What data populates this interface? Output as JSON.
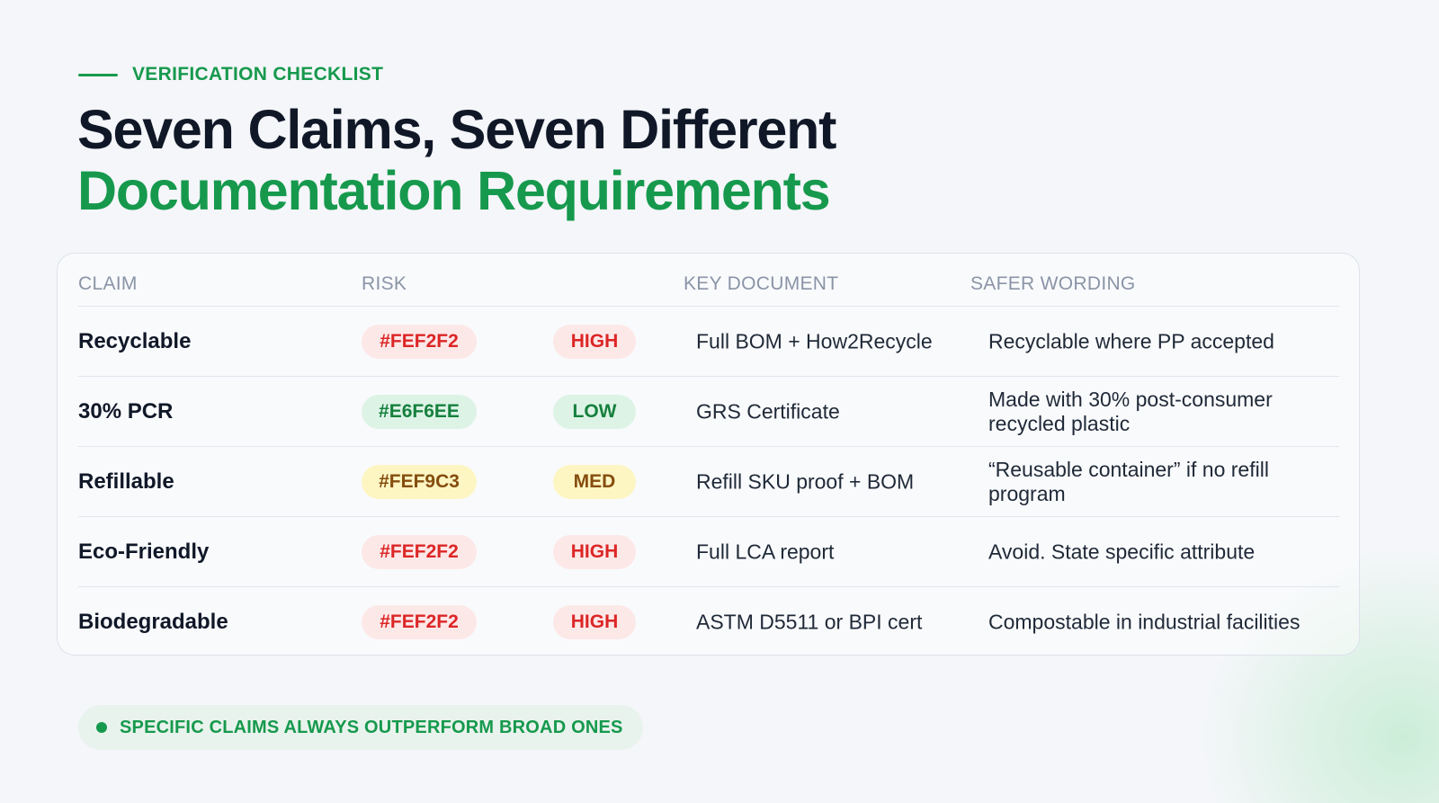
{
  "eyebrow": "VERIFICATION CHECKLIST",
  "title": {
    "line1": "Seven Claims, Seven Different",
    "line2": "Documentation Requirements"
  },
  "table": {
    "headers": {
      "claim": "CLAIM",
      "risk": "RISK",
      "document": "KEY DOCUMENT",
      "wording": "SAFER WORDING"
    },
    "rows": [
      {
        "claim": "Recyclable",
        "hex": "#FEF2F2",
        "level": "HIGH",
        "document": "Full BOM + How2Recycle",
        "wording": "Recyclable where PP accepted"
      },
      {
        "claim": "30% PCR",
        "hex": "#E6F6EE",
        "level": "LOW",
        "document": "GRS Certificate",
        "wording": "Made with 30% post-consumer recycled plastic"
      },
      {
        "claim": "Refillable",
        "hex": "#FEF9C3",
        "level": "MED",
        "document": "Refill SKU proof + BOM",
        "wording": "“Reusable container” if no refill program"
      },
      {
        "claim": "Eco-Friendly",
        "hex": "#FEF2F2",
        "level": "HIGH",
        "document": "Full LCA report",
        "wording": "Avoid. State specific attribute"
      },
      {
        "claim": "Biodegradable",
        "hex": "#FEF2F2",
        "level": "HIGH",
        "document": "ASTM D5511 or BPI cert",
        "wording": "Compostable in industrial facilities"
      }
    ]
  },
  "risk_colors": {
    "HIGH": {
      "bg": "#fde8e8",
      "fg": "#dc2626"
    },
    "LOW": {
      "bg": "#ddf3e6",
      "fg": "#15803d"
    },
    "MED": {
      "bg": "#fdf6c3",
      "fg": "#854d0e"
    }
  },
  "footer": "SPECIFIC CLAIMS ALWAYS OUTPERFORM BROAD ONES"
}
